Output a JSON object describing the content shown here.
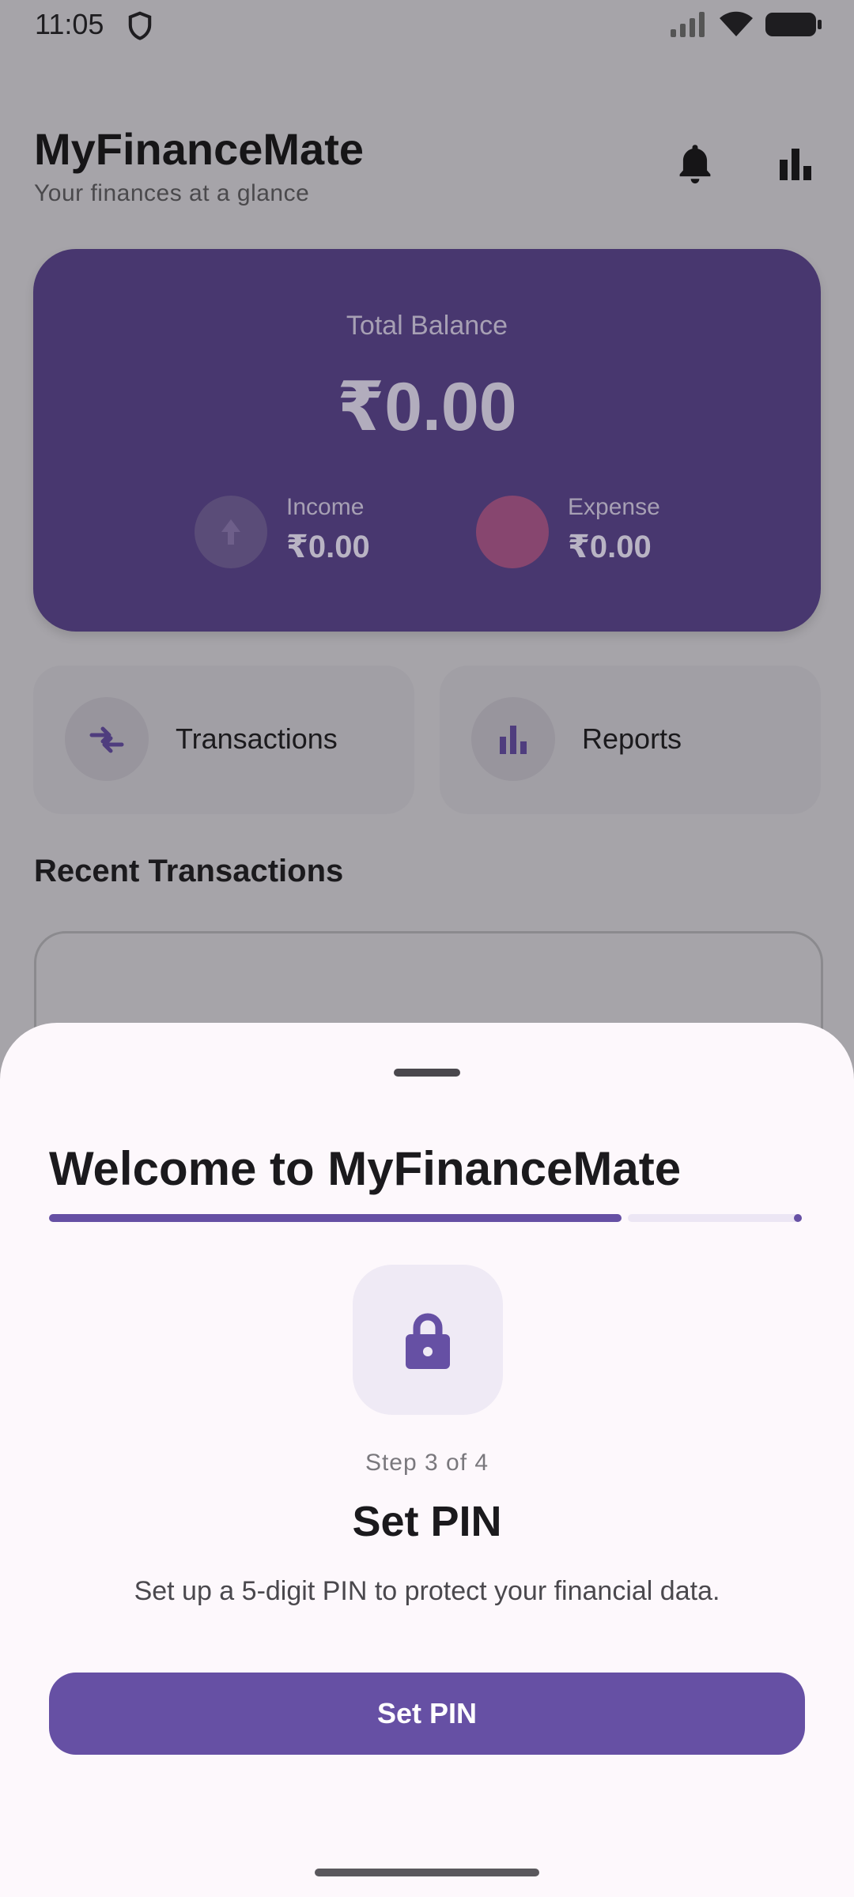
{
  "status_bar": {
    "time": "11:05",
    "icons": [
      "shield-icon",
      "signal-icon",
      "wifi-icon",
      "battery-icon"
    ]
  },
  "header": {
    "title": "MyFinanceMate",
    "subtitle": "Your finances at a glance",
    "icons": [
      "bell-icon",
      "bar-chart-icon"
    ]
  },
  "balance_card": {
    "label": "Total Balance",
    "amount": "₹0.00",
    "income_label": "Income",
    "income_value": "₹0.00",
    "expense_label": "Expense",
    "expense_value": "₹0.00"
  },
  "quick_actions": [
    {
      "label": "Transactions",
      "icon": "swap-arrows-icon"
    },
    {
      "label": "Reports",
      "icon": "bar-chart-icon"
    }
  ],
  "recent": {
    "title": "Recent Transactions"
  },
  "sheet": {
    "title": "Welcome to MyFinanceMate",
    "progress": 0.75,
    "step_text": "Step 3 of 4",
    "step_title": "Set PIN",
    "description": "Set up a 5-digit PIN to protect your financial data.",
    "button_label": "Set PIN",
    "icon": "lock-icon"
  },
  "colors": {
    "primary": "#6650a4",
    "card": "#48376f",
    "scrim": "#a6a4a9",
    "sheet": "#fdf8fc"
  }
}
